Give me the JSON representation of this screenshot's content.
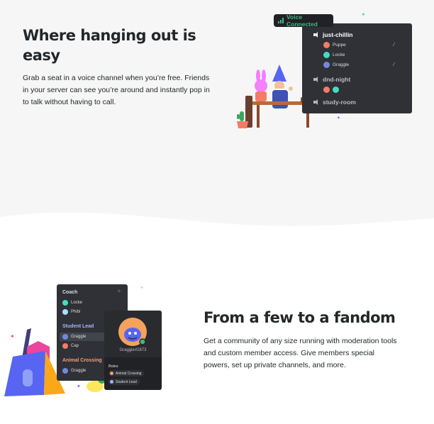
{
  "section1": {
    "title": "Where hanging out is easy",
    "body": "Grab a seat in a voice channel when you’re free. Friends in your server can see you’re around and instantly pop in to talk without having to call."
  },
  "voice_widget": {
    "status": "Voice Connected",
    "channels": [
      {
        "name": "just-chillin",
        "users": [
          {
            "name": "Puppe",
            "color": "#f47b67"
          },
          {
            "name": "Locke",
            "color": "#45ddc0"
          },
          {
            "name": "Graggle",
            "color": "#7289da"
          }
        ]
      },
      {
        "name": "dnd-night"
      },
      {
        "name": "study-room"
      }
    ]
  },
  "section2": {
    "title": "From a few to a fandom",
    "body": "Get a community of any size running with moderation tools and custom member access. Give members special powers, set up private channels, and more."
  },
  "member_widget": {
    "groups": [
      {
        "role": "Coach",
        "color": "#dcddde",
        "members": [
          {
            "name": "Locke",
            "color": "#45ddc0"
          },
          {
            "name": "Phibi",
            "color": "#a6e0ff"
          }
        ]
      },
      {
        "role": "Student Lead",
        "color": "#a5b4fc",
        "members": [
          {
            "name": "Graggle",
            "color": "#7289da"
          },
          {
            "name": "Cap",
            "color": "#f47b67"
          }
        ]
      },
      {
        "role": "Animal Crossing",
        "color": "#f0a07a",
        "members": [
          {
            "name": "Graggle",
            "color": "#7289da"
          }
        ]
      }
    ],
    "profile": {
      "username": "Graggle#2873",
      "roles_label": "Roles",
      "roles": [
        {
          "name": "Animal Crossing",
          "color": "#f0a07a"
        },
        {
          "name": "Student Lead",
          "color": "#a5b4fc"
        }
      ]
    }
  }
}
